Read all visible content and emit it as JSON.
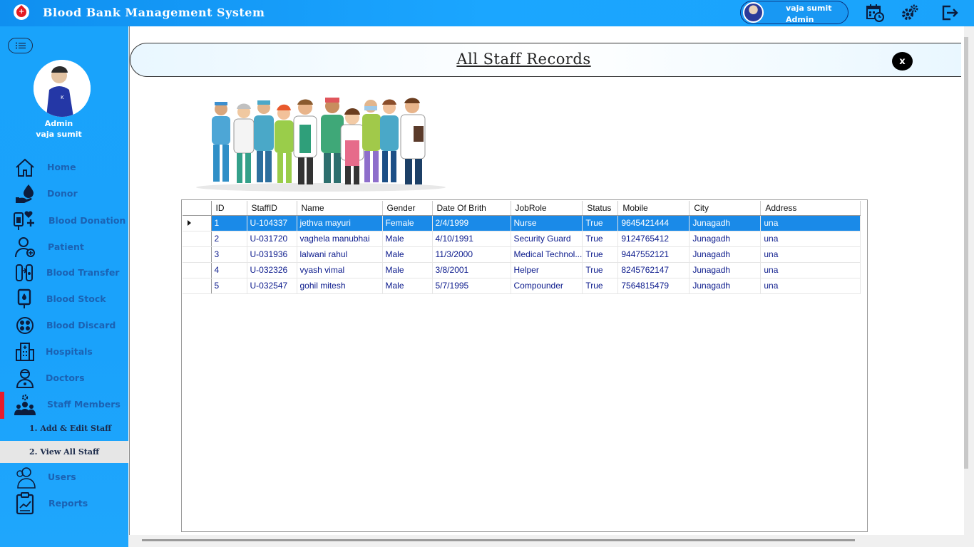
{
  "app": {
    "title": "Blood Bank Management System"
  },
  "header_user": {
    "name": "vaja sumit",
    "role": "Admin"
  },
  "top_icons": [
    "calendar-icon",
    "settings-icon",
    "logout-icon"
  ],
  "sidebar": {
    "profile": {
      "role": "Admin",
      "name": "vaja sumit"
    },
    "items": [
      {
        "label": "Home",
        "icon": "home-icon"
      },
      {
        "label": "Donor",
        "icon": "donor-icon"
      },
      {
        "label": "Blood Donation",
        "icon": "blood-donation-icon"
      },
      {
        "label": "Patient",
        "icon": "patient-icon"
      },
      {
        "label": "Blood Transfer",
        "icon": "blood-transfer-icon"
      },
      {
        "label": "Blood Stock",
        "icon": "blood-stock-icon"
      },
      {
        "label": "Blood Discard",
        "icon": "blood-discard-icon"
      },
      {
        "label": "Hospitals",
        "icon": "hospital-icon"
      },
      {
        "label": "Doctors",
        "icon": "doctor-icon"
      },
      {
        "label": "Staff Members",
        "icon": "staff-icon"
      },
      {
        "label": "Users",
        "icon": "users-icon"
      },
      {
        "label": "Reports",
        "icon": "reports-icon"
      }
    ],
    "sub_items": [
      {
        "label": "1.  Add & Edit Staff"
      },
      {
        "label": "2.  View All Staff"
      }
    ]
  },
  "main": {
    "title": "All Staff Records",
    "close_label": "x"
  },
  "grid": {
    "columns": [
      "ID",
      "StaffID",
      "Name",
      "Gender",
      "Date Of Brith",
      "JobRole",
      "Status",
      "Mobile",
      "City",
      "Address"
    ],
    "rows": [
      [
        "1",
        "U-104337",
        "jethva mayuri",
        "Female",
        "2/4/1999",
        "Nurse",
        "True",
        "9645421444",
        "Junagadh",
        "una"
      ],
      [
        "2",
        "U-031720",
        "vaghela manubhai",
        "Male",
        "4/10/1991",
        "Security Guard",
        "True",
        "9124765412",
        "Junagadh",
        "una"
      ],
      [
        "3",
        "U-031936",
        "lalwani rahul",
        "Male",
        "11/3/2000",
        "Medical Technol...",
        "True",
        "9447552121",
        "Junagadh",
        "una"
      ],
      [
        "4",
        "U-032326",
        "vyash vimal",
        "Male",
        "3/8/2001",
        "Helper",
        "True",
        "8245762147",
        "Junagadh",
        "una"
      ],
      [
        "5",
        "U-032547",
        "gohil mitesh",
        "Male",
        "5/7/1995",
        "Compounder",
        "True",
        "7564815479",
        "Junagadh",
        "una"
      ]
    ],
    "selected_row": 0
  },
  "colors": {
    "accent": "#1aa3fb",
    "selected": "#1a8ae8",
    "active_marker": "#e81b2a"
  }
}
